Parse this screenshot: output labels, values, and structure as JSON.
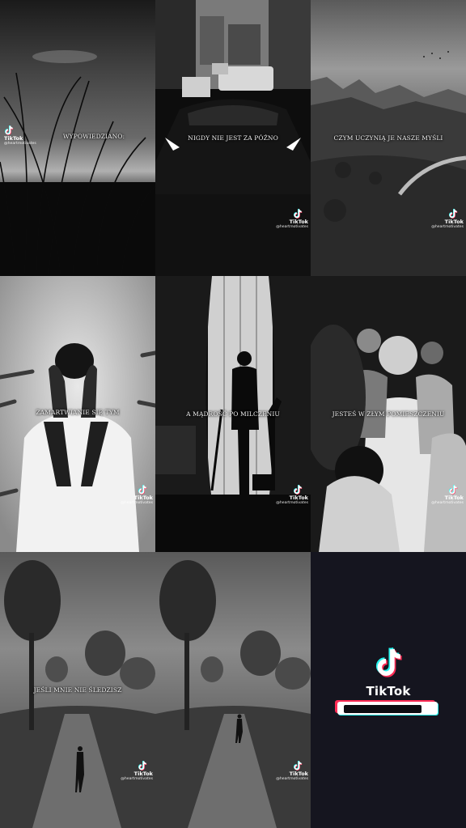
{
  "brand": "TikTok",
  "handle": "@heartmotivates",
  "captions": [
    "WYPOWIEDZIANO:",
    "NIGDY NIE JEST ZA PÓŹNO",
    "CZYM UCZYNIĄ JE NASZE MYŚLI",
    "ZAMARTWIANIE SIĘ TYM",
    "A MĄDROŚĆ PO MILCZENIU",
    "JESTEŚ W ZŁYM POMIESZCZENIU",
    "JEŚLI MNIE NIE ŚLEDZISZ"
  ],
  "endcard": {
    "brand": "TikTok",
    "progress": 0.77
  },
  "colors": {
    "cyan": "#25f4ee",
    "red": "#fe2c55",
    "end_bg": "#15151f"
  },
  "icons": [
    "tiktok-logo-icon"
  ]
}
